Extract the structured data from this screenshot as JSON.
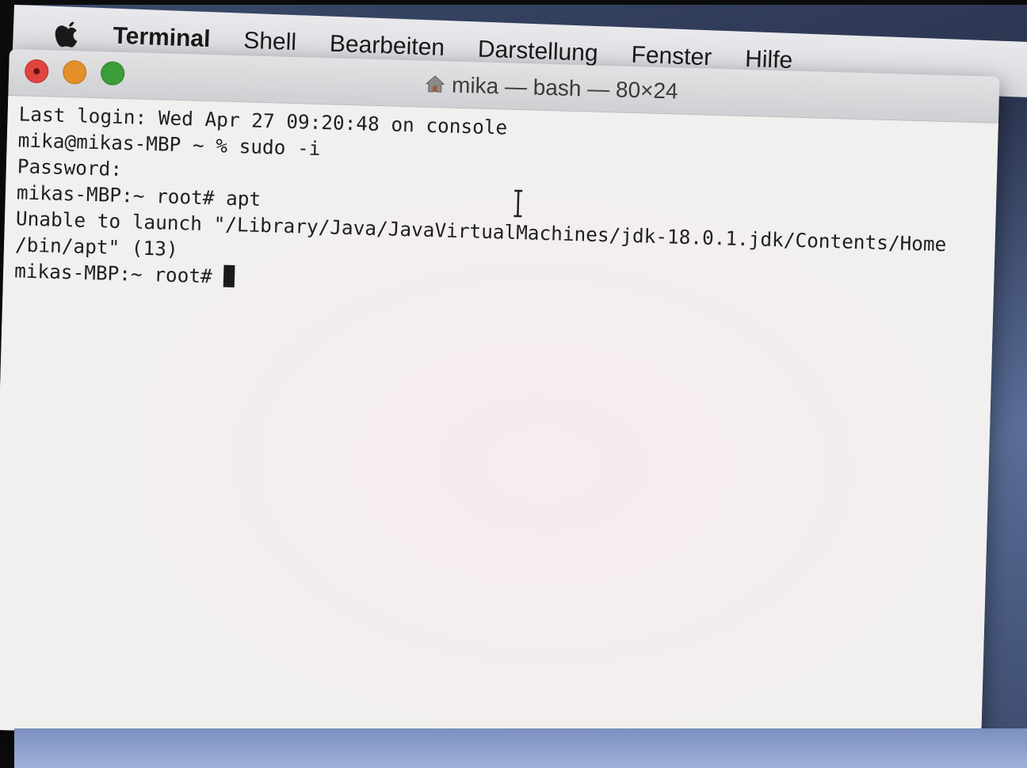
{
  "menubar": {
    "apple_icon": "apple-logo-icon",
    "items": [
      {
        "label": "Terminal"
      },
      {
        "label": "Shell"
      },
      {
        "label": "Bearbeiten"
      },
      {
        "label": "Darstellung"
      },
      {
        "label": "Fenster"
      },
      {
        "label": "Hilfe"
      }
    ]
  },
  "window": {
    "title": "mika — bash — 80×24",
    "title_icon": "home-icon",
    "controls": [
      "close",
      "minimize",
      "zoom"
    ]
  },
  "terminal": {
    "lines": [
      "Last login: Wed Apr 27 09:20:48 on console",
      "mika@mikas-MBP ~ % sudo -i",
      "Password:",
      "mikas-MBP:~ root# apt",
      "Unable to launch \"/Library/Java/JavaVirtualMachines/jdk-18.0.1.jdk/Contents/Home",
      "/bin/apt\" (13)",
      "mikas-MBP:~ root# "
    ]
  },
  "colors": {
    "close": "#e0443e",
    "minimize": "#e3902a",
    "zoom": "#3a9d3a",
    "terminal_bg": "#f1f0ee",
    "terminal_fg": "#1f1f1f"
  }
}
